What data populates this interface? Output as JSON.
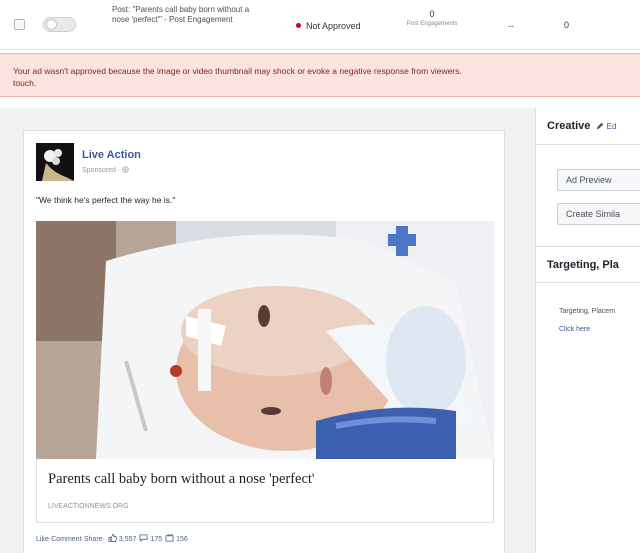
{
  "ad_row": {
    "post_text": "Post: \"Parents call baby born without a nose 'perfect'\" - Post Engagement",
    "status_text": "Not Approved",
    "results_value": "0",
    "results_label": "Post Engagements",
    "reach": "--",
    "spent": "0"
  },
  "warning": {
    "text_line1": "Your ad wasn't approved because the image or video thumbnail may shock or evoke a negative response from viewers.",
    "text_line2": "touch."
  },
  "preview": {
    "page_name": "Live Action",
    "sponsored": "Sponsored · ",
    "post_text": "\"We think he's perfect the way he is.\"",
    "link_headline": "Parents call baby born without a nose 'perfect'",
    "link_domain": "LIVEACTIONNEWS.ORG",
    "actions": {
      "like": "Like",
      "comment": "Comment",
      "share": "Share",
      "sep": " · ",
      "like_count": "3,557",
      "comment_count": "175",
      "share_count": "156"
    }
  },
  "right_panel": {
    "creative_title": "Creative",
    "edit_label": "Ed",
    "ad_preview_button": "Ad Preview",
    "create_similar_button": "Create Simila",
    "targeting_title": "Targeting, Pla",
    "targeting_text": "Targeting, Placem",
    "click_here": "Click here"
  },
  "colors": {
    "warning_bg": "#fbe3df",
    "warning_text": "#7a2b1e",
    "status_dot": "#d0021b",
    "link_blue": "#3b5998"
  },
  "icons": [
    "checkbox-icon",
    "toggle-switch",
    "status-dot-icon",
    "globe-icon",
    "pencil-icon",
    "like-icon",
    "comment-icon",
    "share-icon"
  ]
}
